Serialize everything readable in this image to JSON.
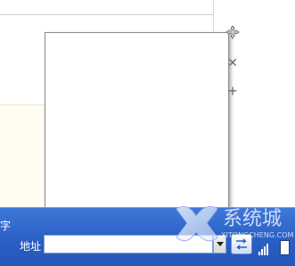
{
  "taskbar": {
    "edge_char": "字",
    "address_label": "地址",
    "address_value": ""
  },
  "icons": {
    "move": "move-icon",
    "close": "close-icon",
    "add": "add-icon",
    "dropdown": "chevron-down-icon",
    "go": "go-icon",
    "signal": "signal-icon",
    "battery": "battery-icon"
  },
  "watermark": {
    "text": "系统城",
    "subtext": "XITONGCHENG.COM"
  },
  "colors": {
    "taskbar": "#2a5fc4",
    "panel_border": "#8c8c8c",
    "cream": "#fffdf2"
  }
}
